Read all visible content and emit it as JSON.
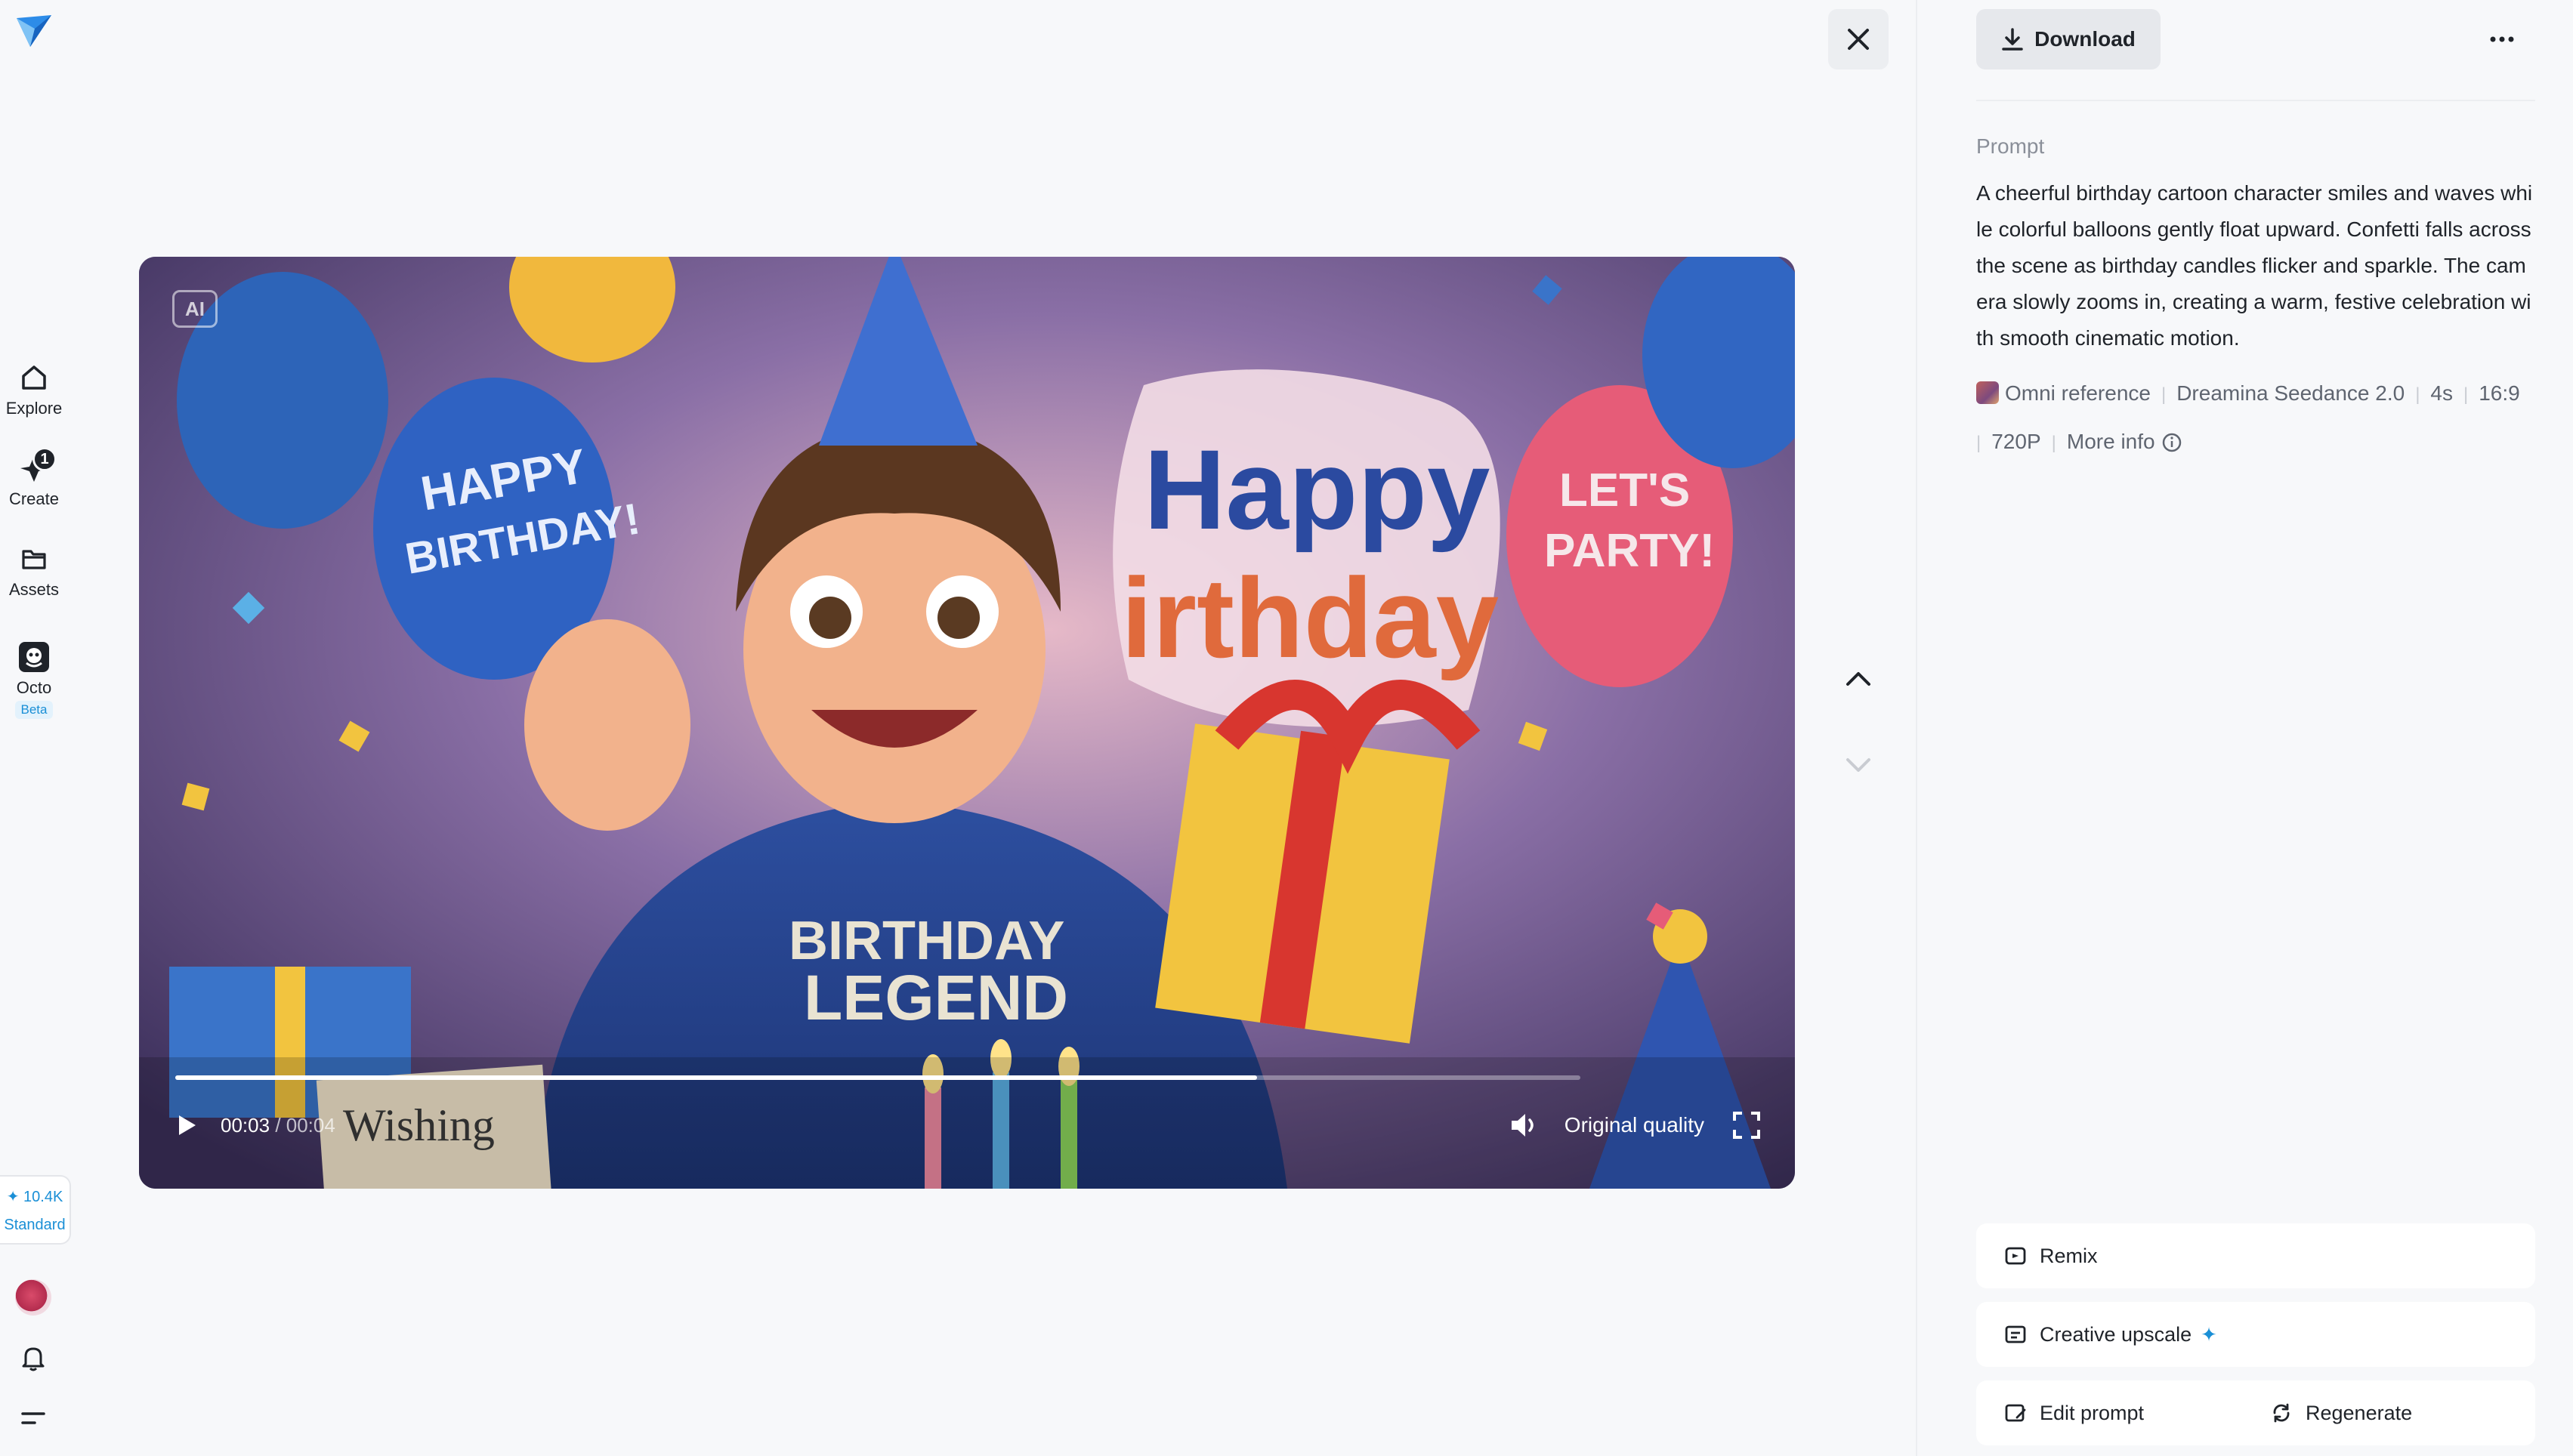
{
  "nav": {
    "items": [
      {
        "label": "Explore",
        "icon": "home-icon"
      },
      {
        "label": "Create",
        "icon": "create-icon",
        "badge": "1"
      },
      {
        "label": "Assets",
        "icon": "folder-icon"
      },
      {
        "label": "Octo",
        "icon": "octo-icon",
        "tag": "Beta"
      }
    ],
    "credits": {
      "amount": "10.4K",
      "tier": "Standard"
    }
  },
  "player": {
    "ai_badge": "AI",
    "current_time": "00:03",
    "duration": "/ 00:04",
    "progress": 0.77,
    "quality": "Original quality"
  },
  "panel": {
    "download_label": "Download",
    "prompt_label": "Prompt",
    "prompt_text": "A cheerful birthday cartoon character smiles and waves while colorful balloons gently float upward. Confetti falls across the scene as birthday candles flicker and sparkle. The camera slowly zooms in, creating a warm, festive celebration with smooth cinematic motion.",
    "meta": {
      "reference": "Omni reference",
      "model": "Dreamina Seedance 2.0",
      "duration": "4s",
      "ratio": "16:9",
      "resolution": "720P",
      "more_info": "More info"
    },
    "actions": {
      "remix": "Remix",
      "upscale": "Creative upscale",
      "edit_prompt": "Edit prompt",
      "regenerate": "Regenerate"
    }
  },
  "colors": {
    "accent": "#1a8fd6",
    "background": "#f7f8fa"
  }
}
